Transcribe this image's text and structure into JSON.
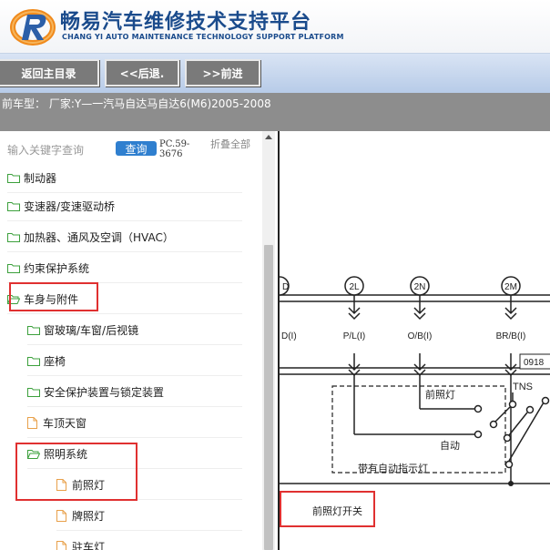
{
  "header": {
    "title": "畅易汽车维修技术支持平台",
    "subtitle": "CHANG YI AUTO MAINTENANCE TECHNOLOGY SUPPORT PLATFORM",
    "accent_color": "#1a4b8c",
    "logo_color": "#f08a1c"
  },
  "nav": {
    "home_label": "返回主目录",
    "back_label": "<<后退.",
    "forward_label": ">>前进"
  },
  "model": {
    "text": "前车型： 厂家:Y—一汽马自达马自达6(M6)2005-2008"
  },
  "search": {
    "placeholder": "输入关键字查询",
    "button_label": "查询",
    "code": "PC.59-3676",
    "collapse_label": "折叠全部"
  },
  "tree": {
    "items": [
      {
        "label": "制动器",
        "type": "folder"
      },
      {
        "label": "变速器/变速驱动桥",
        "type": "folder"
      },
      {
        "label": "加热器、通风及空调（HVAC）",
        "type": "folder"
      },
      {
        "label": "约束保护系统",
        "type": "folder"
      },
      {
        "label": "车身与附件",
        "type": "folder-open"
      },
      {
        "label": "窗玻璃/车窗/后视镜",
        "type": "folder"
      },
      {
        "label": "座椅",
        "type": "folder"
      },
      {
        "label": "安全保护装置与锁定装置",
        "type": "folder"
      },
      {
        "label": "车顶天窗",
        "type": "document"
      },
      {
        "label": "照明系统",
        "type": "folder-open"
      },
      {
        "label": "前照灯",
        "type": "document"
      },
      {
        "label": "牌照灯",
        "type": "document"
      },
      {
        "label": "驻车灯",
        "type": "document"
      }
    ]
  },
  "diagram": {
    "connectors": [
      "2L",
      "2N",
      "2M"
    ],
    "wires": [
      "D(I)",
      "P/L(I)",
      "O/B(I)",
      "BR/B(I)"
    ],
    "connector_code": "0918",
    "labels": {
      "headlight": "前照灯",
      "tns": "TNS",
      "auto": "自动",
      "auto_indicator": "带有自动指示灯",
      "switch": "前照灯开关"
    }
  }
}
